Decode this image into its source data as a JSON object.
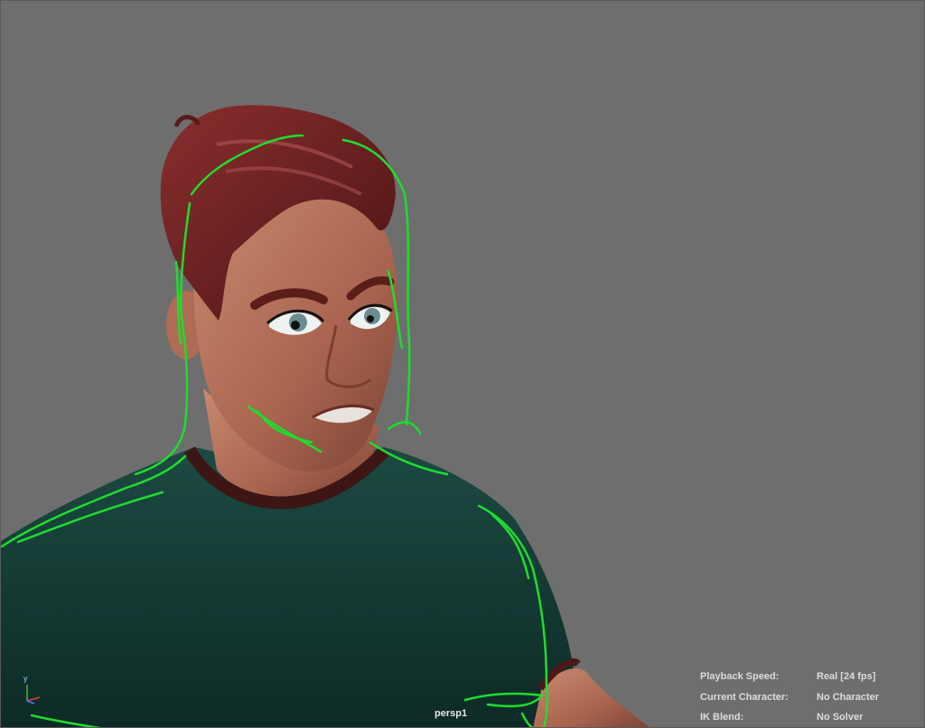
{
  "viewport": {
    "camera": "persp1",
    "axis_y": "y",
    "hud": [
      {
        "label": "Playback Speed:",
        "value": "Real [24 fps]"
      },
      {
        "label": "Current Character:",
        "value": "No Character"
      },
      {
        "label": "IK Blend:",
        "value": "No Solver"
      }
    ]
  },
  "colors": {
    "background": "#6e6e6e",
    "shirt": "#123a33",
    "skin": "#b0705a",
    "hair": "#6b1f1f",
    "sketch_lines": "#1fdc2e",
    "hud_text": "#dcdcdc"
  },
  "icons": {
    "axis_gizmo": "axis-icon"
  }
}
